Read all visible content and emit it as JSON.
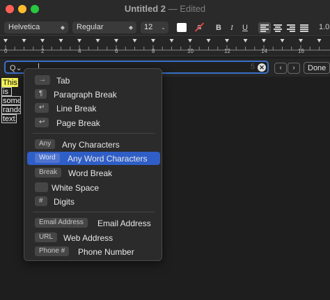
{
  "window": {
    "title": "Untitled 2",
    "separator": "—",
    "status": "Edited"
  },
  "toolbar": {
    "font": "Helvetica",
    "style": "Regular",
    "size": "12",
    "bg_color_glyph": "a",
    "bold": "B",
    "italic": "I",
    "underline": "U",
    "spacing": "1.0"
  },
  "ruler": {
    "numbers": [
      "0",
      "2",
      "4",
      "6",
      "8",
      "10",
      "12",
      "14",
      "16"
    ]
  },
  "find": {
    "search_icon": "Q⌄",
    "count": "5",
    "prev": "‹",
    "next": "›",
    "done": "Done"
  },
  "document": {
    "words": [
      "This",
      "is",
      "some",
      "rando",
      "text."
    ]
  },
  "menu": {
    "items": [
      {
        "token": "→",
        "label": "Tab"
      },
      {
        "token": "¶",
        "label": "Paragraph Break"
      },
      {
        "token": "↵",
        "label": "Line Break"
      },
      {
        "token": "↩",
        "label": "Page Break"
      },
      {
        "token": "Any",
        "label": "Any Characters"
      },
      {
        "token": "Word",
        "label": "Any Word Characters"
      },
      {
        "token": "Break",
        "label": "Word Break"
      },
      {
        "token": "",
        "label": "White Space"
      },
      {
        "token": "#",
        "label": "Digits"
      },
      {
        "token": "Email Address",
        "label": "Email Address"
      },
      {
        "token": "URL",
        "label": "Web Address"
      },
      {
        "token": "Phone #",
        "label": "Phone Number"
      }
    ],
    "selected_label": "Any Word Characters"
  },
  "colors": {
    "accent": "#2f5ec7",
    "highlight": "#f4f059",
    "close": "#ff5f57",
    "minimize": "#febc2e",
    "maximize": "#28c840"
  }
}
